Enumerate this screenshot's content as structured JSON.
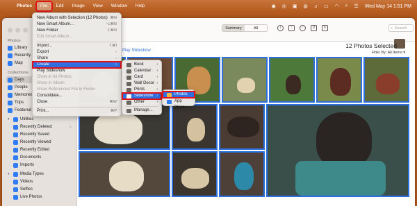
{
  "menubar": {
    "apple": "",
    "items": [
      "Photos",
      "File",
      "Edit",
      "Image",
      "View",
      "Window",
      "Help"
    ],
    "datetime": "Wed May 14  1:51 PM"
  },
  "sidebar": {
    "sections": {
      "photos": "Photos",
      "collections": "Collections"
    },
    "photos_items": [
      "Library",
      "Recently",
      "Map"
    ],
    "collection_items": [
      "Days",
      "People",
      "Memories",
      "Trips",
      "Featured P"
    ],
    "utilities": {
      "label": "Utilities",
      "items": [
        "Recently Deleted",
        "Recently Saved",
        "Recently Viewed",
        "Recently Edited",
        "Documents",
        "Imports"
      ]
    },
    "media_types": {
      "label": "Media Types",
      "items": [
        "Videos",
        "Selfies",
        "Live Photos"
      ]
    }
  },
  "toolbar": {
    "summary": "Summary",
    "all": "All",
    "search_placeholder": "Search"
  },
  "main": {
    "play_slideshow": "Play Slideshow",
    "selected_count": "12 Photos Selected",
    "filter": "Filter By: All Items"
  },
  "file_menu": {
    "items": [
      {
        "label": "New Album with Selection (12 Photos)",
        "shortcut": "⌘N"
      },
      {
        "label": "New Smart Album...",
        "shortcut": "⌥⌘N"
      },
      {
        "label": "New Folder",
        "shortcut": "⇧⌘N"
      },
      {
        "label": "Edit Smart Album...",
        "shortcut": "",
        "disabled": true
      },
      {
        "label": "Import...",
        "shortcut": "⇧⌘I"
      },
      {
        "label": "Export",
        "shortcut": "›"
      },
      {
        "label": "Share",
        "shortcut": "›"
      },
      {
        "label": "Create",
        "shortcut": "›",
        "highlight": true
      },
      {
        "label": "Play Slideshow",
        "shortcut": ""
      },
      {
        "label": "Show in All Photos",
        "shortcut": "",
        "disabled": true
      },
      {
        "label": "Show in Album",
        "shortcut": "",
        "disabled": true
      },
      {
        "label": "Show Referenced File in Finder",
        "shortcut": "",
        "disabled": true
      },
      {
        "label": "Consolidate...",
        "shortcut": ""
      },
      {
        "label": "Close",
        "shortcut": "⌘W"
      },
      {
        "label": "Print...",
        "shortcut": "⌘P"
      }
    ]
  },
  "create_menu": {
    "items": [
      {
        "label": "Book",
        "arrow": "›"
      },
      {
        "label": "Calendar",
        "arrow": "›"
      },
      {
        "label": "Card",
        "arrow": "›"
      },
      {
        "label": "Wall Decor",
        "arrow": "›"
      },
      {
        "label": "Prints",
        "arrow": "›"
      },
      {
        "label": "Slideshow",
        "arrow": "›",
        "highlight": true
      },
      {
        "label": "Other",
        "arrow": "›"
      },
      {
        "label": "Manage...",
        "arrow": ""
      }
    ]
  },
  "slideshow_menu": {
    "items": [
      {
        "label": "Photos",
        "highlight": true
      },
      {
        "label": "App Store..."
      }
    ]
  },
  "colors": {
    "accent": "#2f6fe0",
    "selection_border": "#2e6fe0",
    "annotation_red": "#e0121a",
    "desktop": "#b45a1e"
  }
}
